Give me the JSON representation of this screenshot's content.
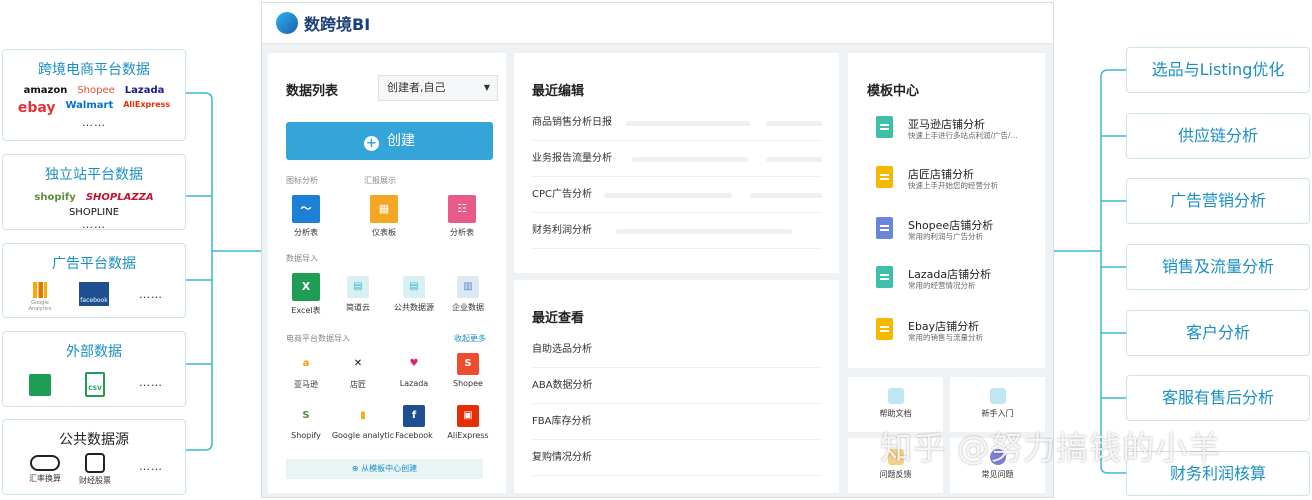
{
  "left_sources": [
    {
      "title": "跨境电商平台数据",
      "logos": [
        "amazon",
        "Shopee",
        "Lazada",
        "ebay",
        "Walmart",
        "AliExpress"
      ],
      "more": "……"
    },
    {
      "title": "独立站平台数据",
      "logos": [
        "shopify",
        "SHOPLAZZA",
        "SHOPLINE"
      ],
      "more": "……"
    },
    {
      "title": "广告平台数据",
      "icons": [
        "Google Analytics",
        "facebook"
      ],
      "more": "……"
    },
    {
      "title": "外部数据",
      "icons": [
        "CSV"
      ],
      "more": "……"
    },
    {
      "title": "公共数据源",
      "icons": [
        "汇率换算",
        "财经股票"
      ],
      "more": "……"
    }
  ],
  "right_targets": [
    "选品与Listing优化",
    "供应链分析",
    "广告营销分析",
    "销售及流量分析",
    "客户分析",
    "客服有售后分析",
    "财务利润核算"
  ],
  "app": {
    "brand": "数跨境BI",
    "data_list": {
      "title": "数据列表",
      "filter_value": "创建者,自己",
      "create_label": "创建",
      "section_chart": "图标分析",
      "section_report": "汇报展示",
      "chart_items": [
        "分析表",
        "仪表板",
        "分析表"
      ],
      "section_import": "数据导入",
      "import_items": [
        "Excel表",
        "简道云",
        "公共数据源",
        "企业数据"
      ],
      "section_ecom": "电商平台数据导入",
      "collapse_more": "收起更多",
      "ecom_items": [
        "亚马逊",
        "店匠",
        "Lazada",
        "Shopee",
        "Shopify",
        "Google analytic",
        "Facebook",
        "AliExpress"
      ],
      "template_link": "从模板中心创建"
    },
    "recent_edit": {
      "title": "最近编辑",
      "items": [
        "商品销售分析日报",
        "业务报告流量分析",
        "CPC广告分析",
        "财务利润分析"
      ]
    },
    "recent_view": {
      "title": "最近查看",
      "items": [
        "自助选品分析",
        "ABA数据分析",
        "FBA库存分析",
        "复购情况分析"
      ]
    },
    "templates": {
      "title": "模板中心",
      "items": [
        {
          "name": "亚马逊店铺分析",
          "desc": "快速上手进行多站点利润/广告/...",
          "color": "#3dbfa8"
        },
        {
          "name": "店匠店铺分析",
          "desc": "快速上手开始您的经营分析",
          "color": "#f5b800"
        },
        {
          "name": "Shopee店铺分析",
          "desc": "常用的利润与广告分析",
          "color": "#6a86d8"
        },
        {
          "name": "Lazada店铺分析",
          "desc": "常用的经营情况分析",
          "color": "#3dbfa8"
        },
        {
          "name": "Ebay店铺分析",
          "desc": "常用的销售与流量分析",
          "color": "#f5b800"
        }
      ]
    },
    "help": [
      "帮助文档",
      "新手入门",
      "问题反馈",
      "常见问题"
    ]
  },
  "watermark": "知乎 @努力搞钱的小羊"
}
